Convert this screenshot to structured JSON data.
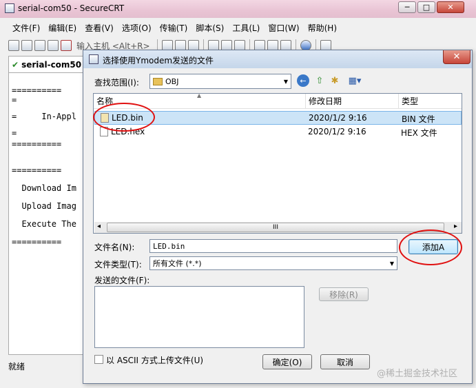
{
  "window": {
    "title": "serial-com50 - SecureCRT",
    "minimize_glyph": "─",
    "maximize_glyph": "□",
    "close_glyph": "✕"
  },
  "menu": [
    "文件(F)",
    "编辑(E)",
    "查看(V)",
    "选项(O)",
    "传输(T)",
    "脚本(S)",
    "工具(L)",
    "窗口(W)",
    "帮助(H)"
  ],
  "toolbar": {
    "host_placeholder": "输入主机 <Alt+R>"
  },
  "tab": {
    "label": "serial-com50"
  },
  "terminal": {
    "lines": [
      "==========",
      "=",
      "=     In-Appl",
      "=",
      "==========",
      "==========",
      "  Download Im",
      "  Upload Imag",
      "  Execute The",
      "=========="
    ]
  },
  "status": {
    "text": "就绪"
  },
  "dialog": {
    "title": "选择使用Ymodem发送的文件",
    "close_glyph": "✕",
    "look_in_label": "查找范围(I):",
    "look_in_value": "OBJ",
    "columns": [
      "名称",
      "修改日期",
      "类型"
    ],
    "files": [
      {
        "name": "LED.bin",
        "date": "2020/1/2 9:16",
        "type": "BIN 文件"
      },
      {
        "name": "LED.hex",
        "date": "2020/1/2 9:16",
        "type": "HEX 文件"
      }
    ],
    "filename_label": "文件名(N):",
    "filename_value": "LED.bin",
    "add_button": "添加A",
    "filetype_label": "文件类型(T):",
    "filetype_value": "所有文件 (*.*)",
    "sent_files_label": "发送的文件(F):",
    "remove_button": "移除(R)",
    "ascii_label": "以 ASCII 方式上传文件(U)",
    "ok_button": "确定(O)",
    "cancel_button": "取消",
    "scroll_left": "◂",
    "scroll_right": "▸",
    "scroll_grip": "III"
  },
  "watermark": "@稀土掘金技术社区",
  "annotation_color": "#e01010"
}
